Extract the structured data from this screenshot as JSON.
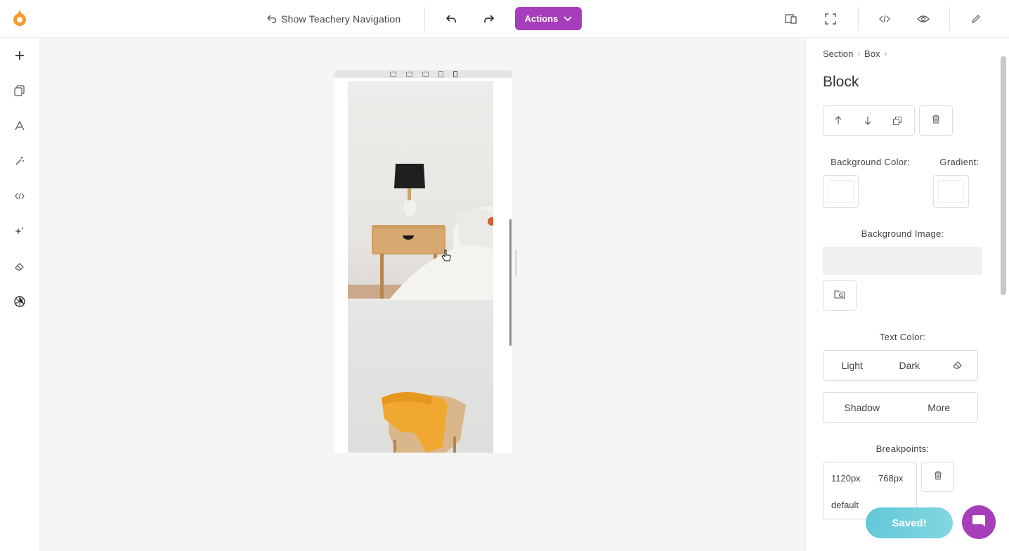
{
  "topbar": {
    "show_nav_label": "Show Teachery Navigation",
    "actions_label": "Actions",
    "icons": [
      "undo-icon",
      "redo-icon",
      "responsive-preview-icon",
      "fullscreen-icon",
      "code-icon",
      "eye-icon",
      "pencil-icon"
    ]
  },
  "sidebar": {
    "icons": [
      "plus-icon",
      "pages-icon",
      "typography-icon",
      "magic-wand-icon",
      "code-icon",
      "sparkles-icon",
      "eraser-icon",
      "openai-icon"
    ]
  },
  "canvas": {
    "device_icons": [
      "desktop-icon",
      "laptop-icon",
      "tablet-landscape-icon",
      "tablet-portrait-icon",
      "mobile-icon"
    ],
    "images": [
      "bedside-table-lamp-photo",
      "chair-with-yellow-throw-photo"
    ]
  },
  "panel": {
    "breadcrumb": [
      "Section",
      "Box"
    ],
    "title": "Block",
    "background_color_label": "Background Color:",
    "gradient_label": "Gradient:",
    "background_image_label": "Background Image:",
    "text_color_label": "Text Color:",
    "text_color_options": [
      "Light",
      "Dark"
    ],
    "shadow_label": "Shadow",
    "more_label": "More",
    "breakpoints_label": "Breakpoints:",
    "breakpoints": [
      "1120px",
      "768px",
      "default"
    ]
  },
  "saved_label": "Saved!",
  "colors": {
    "accent": "#a63dbb",
    "saved": "#6fcfdc",
    "logo": "#f39c2b"
  }
}
